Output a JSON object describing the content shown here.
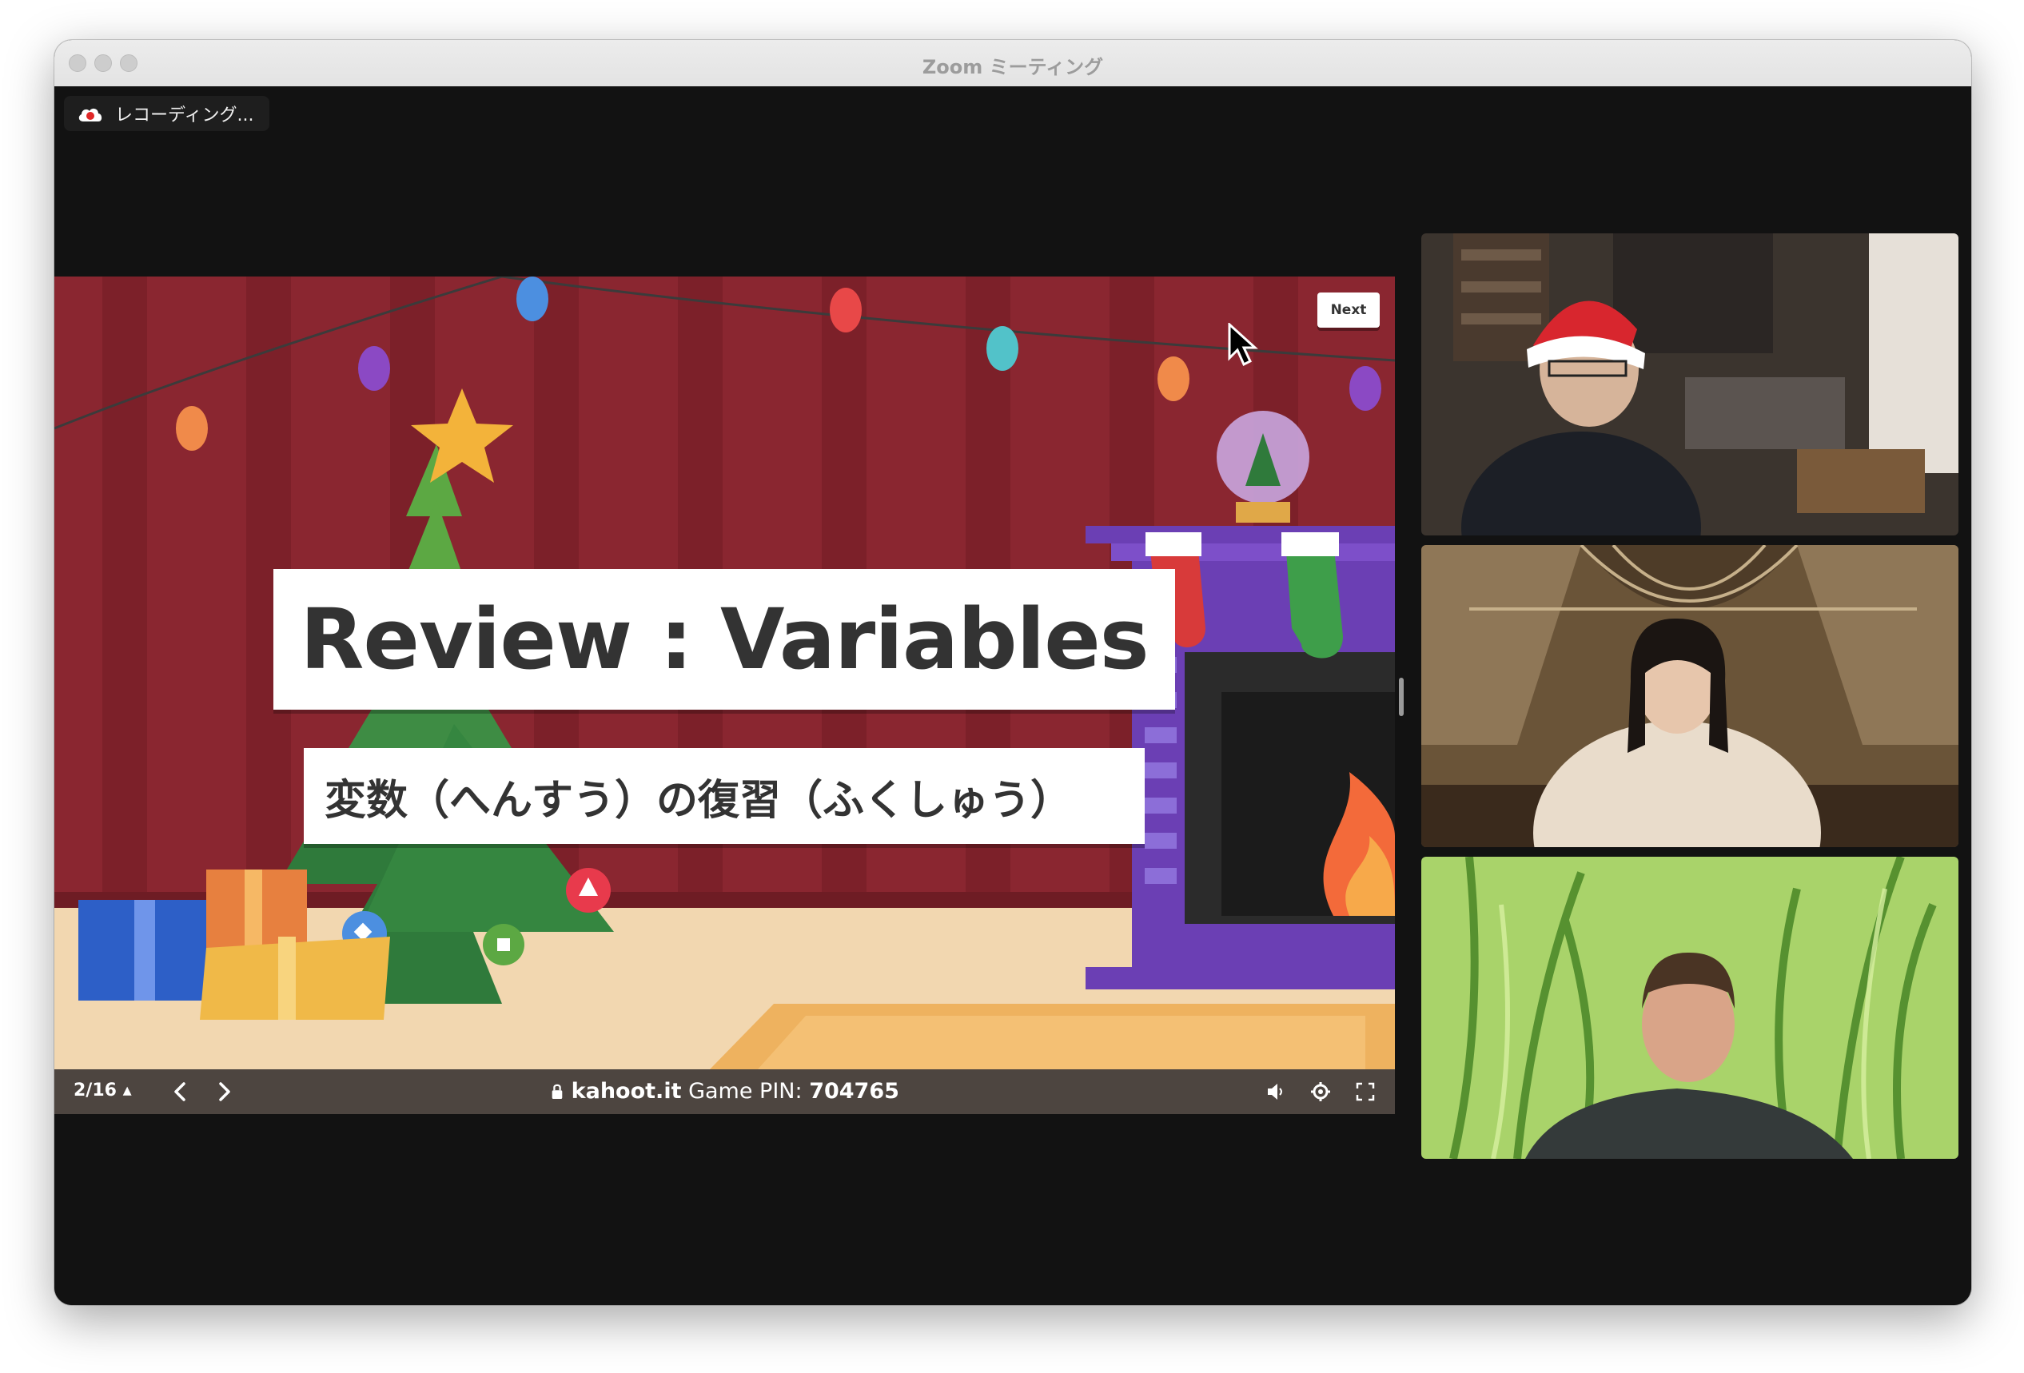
{
  "window": {
    "title": "Zoom ミーティング"
  },
  "recording": {
    "label": "レコーディング..."
  },
  "slide": {
    "title": "Review : Variables",
    "subtitle": "変数（へんすう）の復習（ふくしゅう）",
    "next_label": "Next"
  },
  "share_bar": {
    "slide_counter": "2/16 ▴",
    "host": "kahoot.it",
    "pin_label": "Game PIN:",
    "pin_value": "704765"
  },
  "icons": {
    "recording": "cloud-record-icon",
    "lock": "lock-icon",
    "prev": "chevron-left-icon",
    "next": "chevron-right-icon",
    "volume": "speaker-icon",
    "settings": "gear-icon",
    "fullscreen": "fullscreen-icon"
  },
  "participants": [
    {
      "id": 1,
      "background": "home office",
      "detail": "santa hat"
    },
    {
      "id": 2,
      "background": "gothic library hall"
    },
    {
      "id": 3,
      "background": "green grass"
    }
  ],
  "colors": {
    "slide_bg": "#8a2630",
    "card_bg": "#ffffff",
    "bar_bg": "#4d4540",
    "window_bg": "#121212"
  }
}
